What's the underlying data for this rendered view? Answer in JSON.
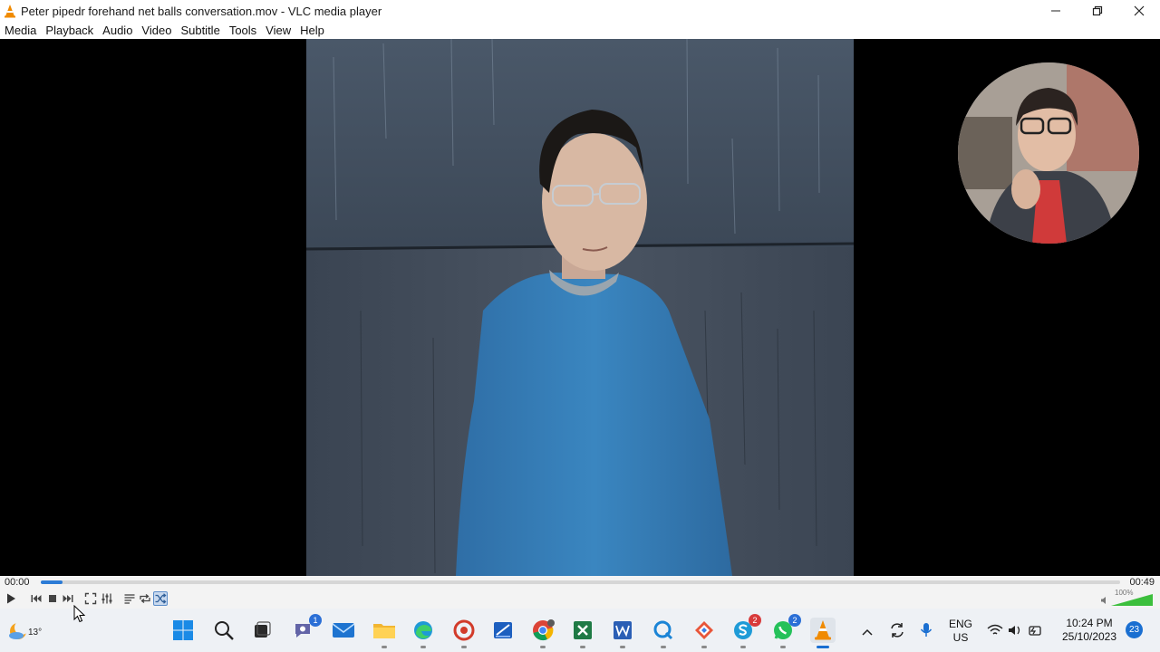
{
  "window": {
    "title": "Peter pipedr forehand net balls conversation.mov - VLC media player",
    "controls": {
      "minimize": "—",
      "maximize": "❐",
      "close": "✕"
    }
  },
  "menu": [
    "Media",
    "Playback",
    "Audio",
    "Video",
    "Subtitle",
    "Tools",
    "View",
    "Help"
  ],
  "player": {
    "elapsed": "00:00",
    "duration": "00:49",
    "progress_fraction": 0.02,
    "volume_percent": "100%",
    "volume_level": 1.0
  },
  "taskbar": {
    "weather_temp": "13°",
    "apps": [
      {
        "name": "start",
        "icon": "windows-icon"
      },
      {
        "name": "search",
        "icon": "search-icon"
      },
      {
        "name": "task-view",
        "icon": "task-view-icon"
      },
      {
        "name": "teams",
        "icon": "teams-icon",
        "badge": "1"
      },
      {
        "name": "mail",
        "icon": "mail-icon"
      },
      {
        "name": "file-explorer",
        "icon": "folder-icon"
      },
      {
        "name": "edge",
        "icon": "edge-icon"
      },
      {
        "name": "app-red",
        "icon": "app-icon"
      },
      {
        "name": "snip",
        "icon": "snip-icon"
      },
      {
        "name": "chrome",
        "icon": "chrome-icon"
      },
      {
        "name": "excel",
        "icon": "excel-icon"
      },
      {
        "name": "word",
        "icon": "word-icon"
      },
      {
        "name": "quick-assist",
        "icon": "quick-assist-icon"
      },
      {
        "name": "app-mixed",
        "icon": "app-icon"
      },
      {
        "name": "skype",
        "icon": "skype-icon",
        "badge": "2"
      },
      {
        "name": "whatsapp",
        "icon": "whatsapp-icon",
        "badge": "2"
      },
      {
        "name": "vlc",
        "icon": "vlc-icon"
      }
    ],
    "lang_line1": "ENG",
    "lang_line2": "US",
    "time": "10:24 PM",
    "date": "25/10/2023",
    "notification_count": "23"
  },
  "colors": {
    "accent": "#1a6fd1",
    "vlc_orange": "#f08a00",
    "seek_fill": "#2c7bd6"
  }
}
